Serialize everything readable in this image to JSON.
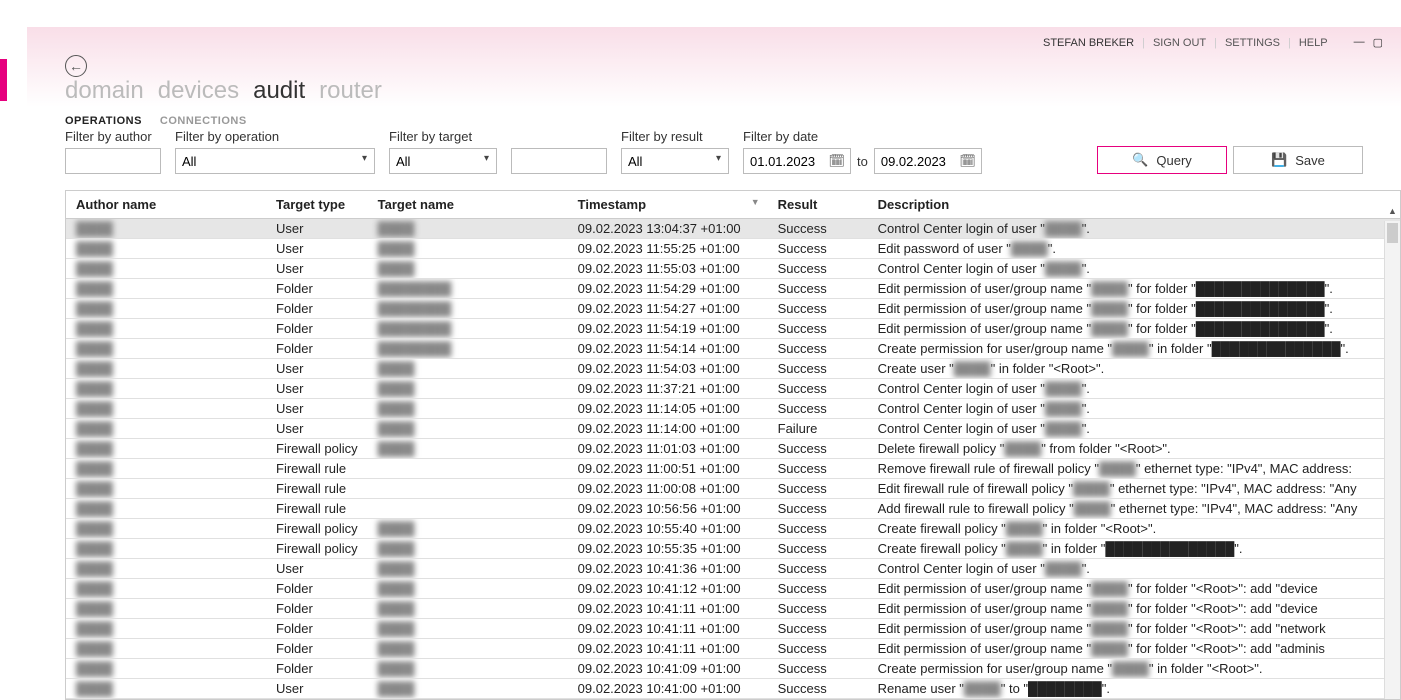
{
  "header": {
    "user_name": "STEFAN BREKER",
    "sign_out": "SIGN OUT",
    "settings": "SETTINGS",
    "help": "HELP"
  },
  "main_tabs": {
    "domain": "domain",
    "devices": "devices",
    "audit": "audit",
    "router": "router",
    "active": "audit"
  },
  "sub_tabs": {
    "operations": "OPERATIONS",
    "connections": "CONNECTIONS",
    "active": "operations"
  },
  "filters": {
    "author": {
      "label": "Filter by author",
      "value": ""
    },
    "operation": {
      "label": "Filter by operation",
      "value": "All"
    },
    "target": {
      "label": "Filter by target",
      "select_value": "All",
      "text_value": ""
    },
    "result": {
      "label": "Filter by result",
      "value": "All"
    },
    "date": {
      "label": "Filter by date",
      "from": "01.01.2023",
      "to_label": "to",
      "to": "09.02.2023"
    }
  },
  "actions": {
    "query": "Query",
    "save": "Save"
  },
  "table": {
    "columns": {
      "author": "Author name",
      "target_type": "Target type",
      "target_name": "Target name",
      "timestamp": "Timestamp",
      "result": "Result",
      "description": "Description"
    },
    "rows": [
      {
        "author": "████",
        "target_type": "User",
        "target_name": "████",
        "timestamp": "09.02.2023 13:04:37 +01:00",
        "result": "Success",
        "desc_pre": "Control Center login of user \"",
        "desc_blur": "████",
        "desc_post": "\"."
      },
      {
        "author": "████",
        "target_type": "User",
        "target_name": "████",
        "timestamp": "09.02.2023 11:55:25 +01:00",
        "result": "Success",
        "desc_pre": "Edit password of user \"",
        "desc_blur": "████",
        "desc_post": "\"."
      },
      {
        "author": "████",
        "target_type": "User",
        "target_name": "████",
        "timestamp": "09.02.2023 11:55:03 +01:00",
        "result": "Success",
        "desc_pre": "Control Center login of user \"",
        "desc_blur": "████",
        "desc_post": "\"."
      },
      {
        "author": "████",
        "target_type": "Folder",
        "target_name": "████████",
        "timestamp": "09.02.2023 11:54:29 +01:00",
        "result": "Success",
        "desc_pre": "Edit permission of user/group name \"",
        "desc_blur": "████",
        "desc_post": "\" for folder \"██████████████\"."
      },
      {
        "author": "████",
        "target_type": "Folder",
        "target_name": "████████",
        "timestamp": "09.02.2023 11:54:27 +01:00",
        "result": "Success",
        "desc_pre": "Edit permission of user/group name \"",
        "desc_blur": "████",
        "desc_post": "\" for folder \"██████████████\"."
      },
      {
        "author": "████",
        "target_type": "Folder",
        "target_name": "████████",
        "timestamp": "09.02.2023 11:54:19 +01:00",
        "result": "Success",
        "desc_pre": "Edit permission of user/group name \"",
        "desc_blur": "████",
        "desc_post": "\" for folder \"██████████████\"."
      },
      {
        "author": "████",
        "target_type": "Folder",
        "target_name": "████████",
        "timestamp": "09.02.2023 11:54:14 +01:00",
        "result": "Success",
        "desc_pre": "Create permission for user/group name \"",
        "desc_blur": "████",
        "desc_post": "\" in folder \"██████████████\"."
      },
      {
        "author": "████",
        "target_type": "User",
        "target_name": "████",
        "timestamp": "09.02.2023 11:54:03 +01:00",
        "result": "Success",
        "desc_pre": "Create user \"",
        "desc_blur": "████",
        "desc_post": "\" in folder \"<Root>\"."
      },
      {
        "author": "████",
        "target_type": "User",
        "target_name": "████",
        "timestamp": "09.02.2023 11:37:21 +01:00",
        "result": "Success",
        "desc_pre": "Control Center login of user \"",
        "desc_blur": "████",
        "desc_post": "\"."
      },
      {
        "author": "████",
        "target_type": "User",
        "target_name": "████",
        "timestamp": "09.02.2023 11:14:05 +01:00",
        "result": "Success",
        "desc_pre": "Control Center login of user \"",
        "desc_blur": "████",
        "desc_post": "\"."
      },
      {
        "author": "████",
        "target_type": "User",
        "target_name": "████",
        "timestamp": "09.02.2023 11:14:00 +01:00",
        "result": "Failure",
        "desc_pre": "Control Center login of user \"",
        "desc_blur": "████",
        "desc_post": "\"."
      },
      {
        "author": "████",
        "target_type": "Firewall policy",
        "target_name": "████",
        "timestamp": "09.02.2023 11:01:03 +01:00",
        "result": "Success",
        "desc_pre": "Delete firewall policy \"",
        "desc_blur": "████",
        "desc_post": "\" from folder \"<Root>\"."
      },
      {
        "author": "████",
        "target_type": "Firewall rule",
        "target_name": "",
        "timestamp": "09.02.2023 11:00:51 +01:00",
        "result": "Success",
        "desc_pre": "Remove firewall rule of firewall policy \"",
        "desc_blur": "████",
        "desc_post": "\" ethernet type: \"IPv4\", MAC address:"
      },
      {
        "author": "████",
        "target_type": "Firewall rule",
        "target_name": "",
        "timestamp": "09.02.2023 11:00:08 +01:00",
        "result": "Success",
        "desc_pre": "Edit firewall rule of firewall policy \"",
        "desc_blur": "████",
        "desc_post": "\" ethernet type: \"IPv4\", MAC address: \"Any"
      },
      {
        "author": "████",
        "target_type": "Firewall rule",
        "target_name": "",
        "timestamp": "09.02.2023 10:56:56 +01:00",
        "result": "Success",
        "desc_pre": "Add firewall rule to firewall policy \"",
        "desc_blur": "████",
        "desc_post": "\" ethernet type: \"IPv4\", MAC address: \"Any"
      },
      {
        "author": "████",
        "target_type": "Firewall policy",
        "target_name": "████",
        "timestamp": "09.02.2023 10:55:40 +01:00",
        "result": "Success",
        "desc_pre": "Create firewall policy \"",
        "desc_blur": "████",
        "desc_post": "\" in folder \"<Root>\"."
      },
      {
        "author": "████",
        "target_type": "Firewall policy",
        "target_name": "████",
        "timestamp": "09.02.2023 10:55:35 +01:00",
        "result": "Success",
        "desc_pre": "Create firewall policy \"",
        "desc_blur": "████",
        "desc_post": "\" in folder \"██████████████\"."
      },
      {
        "author": "████",
        "target_type": "User",
        "target_name": "████",
        "timestamp": "09.02.2023 10:41:36 +01:00",
        "result": "Success",
        "desc_pre": "Control Center login of user \"",
        "desc_blur": "████",
        "desc_post": "\"."
      },
      {
        "author": "████",
        "target_type": "Folder",
        "target_name": "████",
        "timestamp": "09.02.2023 10:41:12 +01:00",
        "result": "Success",
        "desc_pre": "Edit permission of user/group name \"",
        "desc_blur": "████",
        "desc_post": "\" for folder \"<Root>\": add \"device"
      },
      {
        "author": "████",
        "target_type": "Folder",
        "target_name": "████",
        "timestamp": "09.02.2023 10:41:11 +01:00",
        "result": "Success",
        "desc_pre": "Edit permission of user/group name \"",
        "desc_blur": "████",
        "desc_post": "\" for folder \"<Root>\": add \"device"
      },
      {
        "author": "████",
        "target_type": "Folder",
        "target_name": "████",
        "timestamp": "09.02.2023 10:41:11 +01:00",
        "result": "Success",
        "desc_pre": "Edit permission of user/group name \"",
        "desc_blur": "████",
        "desc_post": "\" for folder \"<Root>\": add \"network"
      },
      {
        "author": "████",
        "target_type": "Folder",
        "target_name": "████",
        "timestamp": "09.02.2023 10:41:11 +01:00",
        "result": "Success",
        "desc_pre": "Edit permission of user/group name \"",
        "desc_blur": "████",
        "desc_post": "\" for folder \"<Root>\": add \"adminis"
      },
      {
        "author": "████",
        "target_type": "Folder",
        "target_name": "████",
        "timestamp": "09.02.2023 10:41:09 +01:00",
        "result": "Success",
        "desc_pre": "Create permission for user/group name \"",
        "desc_blur": "████",
        "desc_post": "\" in folder \"<Root>\"."
      },
      {
        "author": "████",
        "target_type": "User",
        "target_name": "████",
        "timestamp": "09.02.2023 10:41:00 +01:00",
        "result": "Success",
        "desc_pre": "Rename user \"",
        "desc_blur": "████",
        "desc_post": "\" to \"████████\"."
      }
    ]
  }
}
